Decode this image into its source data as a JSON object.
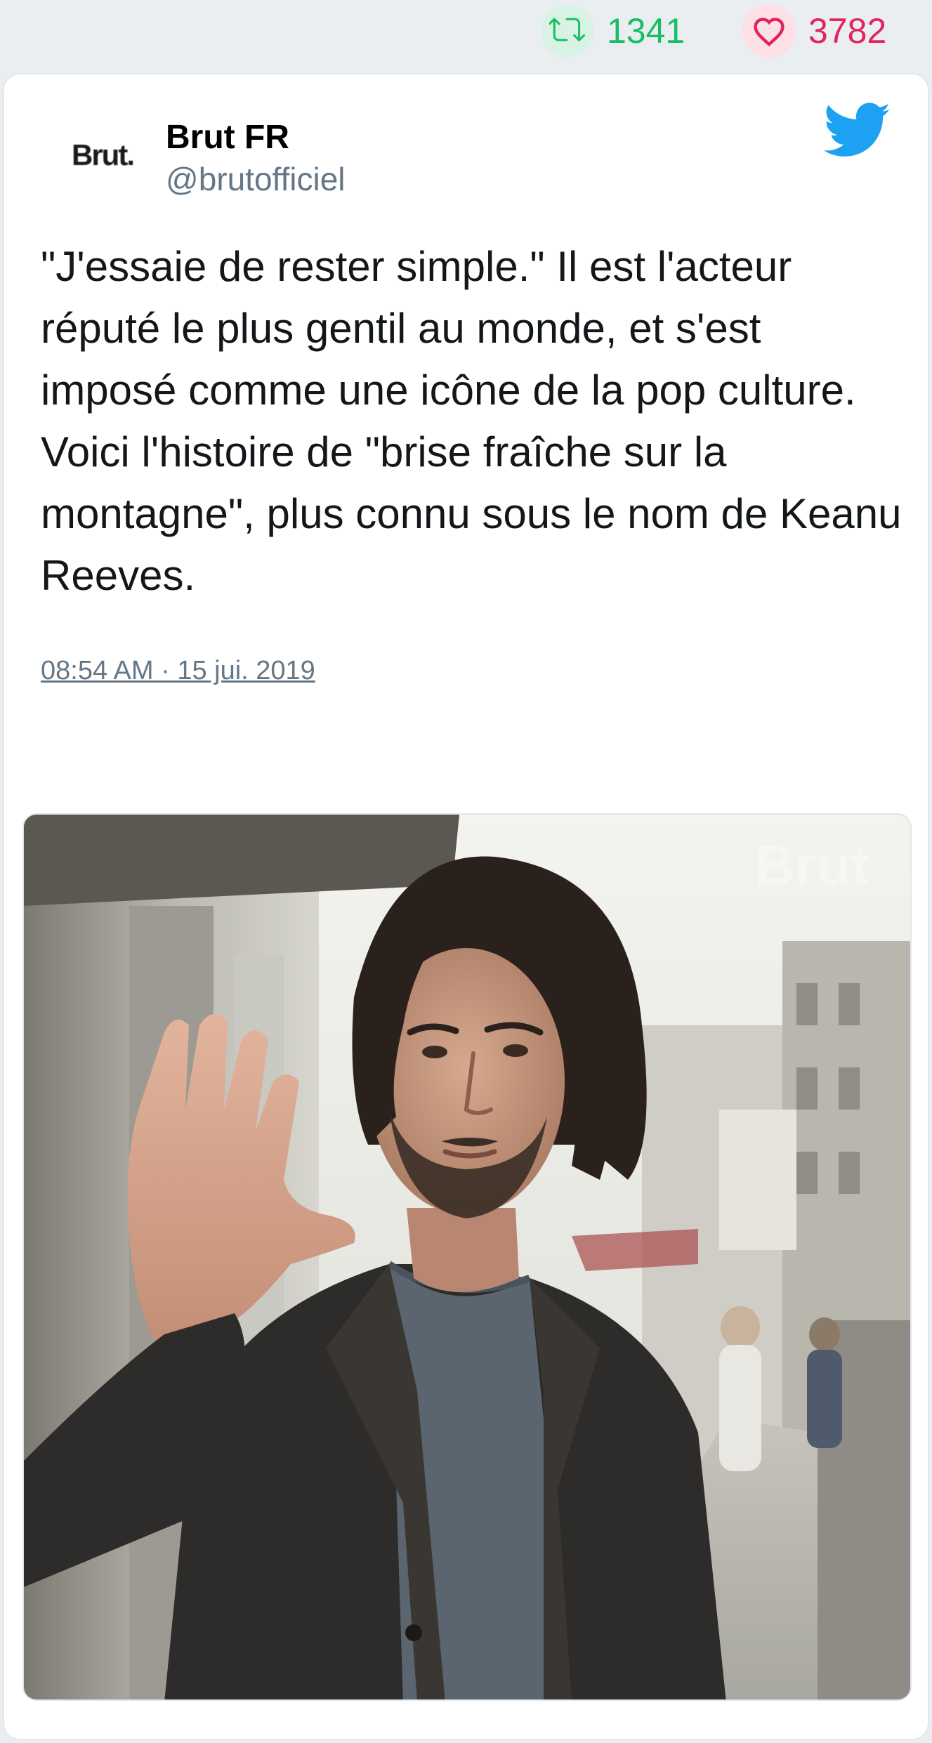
{
  "stats": {
    "retweets": "1341",
    "likes": "3782",
    "retweet_color": "#17bf63",
    "like_color": "#e0245e"
  },
  "author": {
    "avatar_text": "Brut.",
    "name": "Brut FR",
    "handle": "@brutofficiel"
  },
  "tweet": {
    "text": "\"J'essaie de rester simple.\" Il est l'acteur réputé le plus gentil au monde, et s'est imposé comme une icône de la pop culture. Voici l'histoire de \"brise fraîche sur la montagne\", plus connu sous le nom de Keanu Reeves.",
    "timestamp": "08:54 AM · 15 jui. 2019"
  },
  "actions": {
    "reply_icon": "reply-icon",
    "retweet_icon": "retweet-icon",
    "like_icon": "heart-icon"
  },
  "media": {
    "description_icon": "photo",
    "watermark": "Brut"
  },
  "colors": {
    "twitter_blue": "#1da1f2",
    "text": "#14171a",
    "muted": "#657786"
  }
}
